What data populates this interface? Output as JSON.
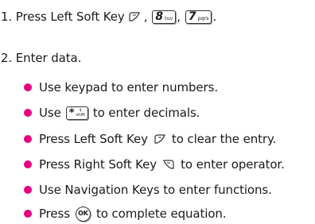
{
  "step1": {
    "text_before": "1. Press Left Soft Key",
    "key_8": {
      "digit": "8",
      "letters": "tuv"
    },
    "key_7": {
      "digit": "7",
      "letters": "pqrs"
    },
    "comma_1": ",",
    "comma_2": ",",
    "period": "."
  },
  "step2": {
    "text": "2. Enter data."
  },
  "bullets": {
    "b1": "Use keypad to enter numbers.",
    "b2_before": "Use",
    "b2_after": "to enter decimals.",
    "b2_key": {
      "symbol": "*",
      "sub_top": "‡",
      "sub_bottom": "shift"
    },
    "b3_before": "Press Left Soft Key",
    "b3_after": "to clear the entry.",
    "b4_before": "Press Right Soft Key",
    "b4_after": "to enter operator.",
    "b5": "Use Navigation Keys to enter functions.",
    "b6_before": "Press",
    "b6_after": "to complete equation.",
    "ok_label": "OK"
  },
  "colors": {
    "bullet": "#e4007c",
    "text": "#1a1a1a"
  },
  "icons": {
    "left_soft_key": "left-soft-key-icon",
    "right_soft_key": "right-soft-key-icon",
    "ok_key": "ok-key-icon"
  }
}
